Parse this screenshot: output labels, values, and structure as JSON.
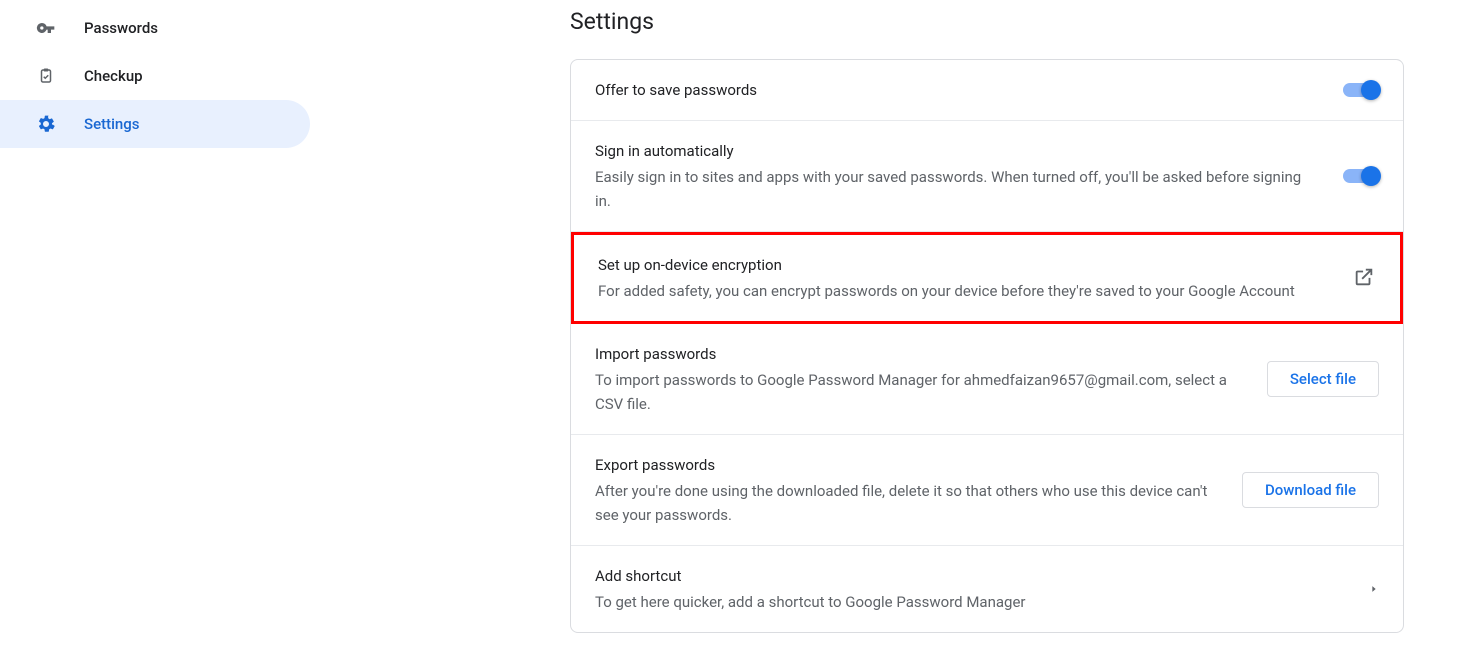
{
  "sidebar": {
    "items": [
      {
        "label": "Passwords"
      },
      {
        "label": "Checkup"
      },
      {
        "label": "Settings"
      }
    ]
  },
  "page": {
    "title": "Settings"
  },
  "settings": {
    "offer_save": {
      "title": "Offer to save passwords"
    },
    "auto_signin": {
      "title": "Sign in automatically",
      "desc": "Easily sign in to sites and apps with your saved passwords. When turned off, you'll be asked before signing in."
    },
    "encryption": {
      "title": "Set up on-device encryption",
      "desc": "For added safety, you can encrypt passwords on your device before they're saved to your Google Account"
    },
    "import": {
      "title": "Import passwords",
      "desc": "To import passwords to Google Password Manager for ahmedfaizan9657@gmail.com, select a CSV file.",
      "button": "Select file"
    },
    "export": {
      "title": "Export passwords",
      "desc": "After you're done using the downloaded file, delete it so that others who use this device can't see your passwords.",
      "button": "Download file"
    },
    "shortcut": {
      "title": "Add shortcut",
      "desc": "To get here quicker, add a shortcut to Google Password Manager"
    }
  }
}
